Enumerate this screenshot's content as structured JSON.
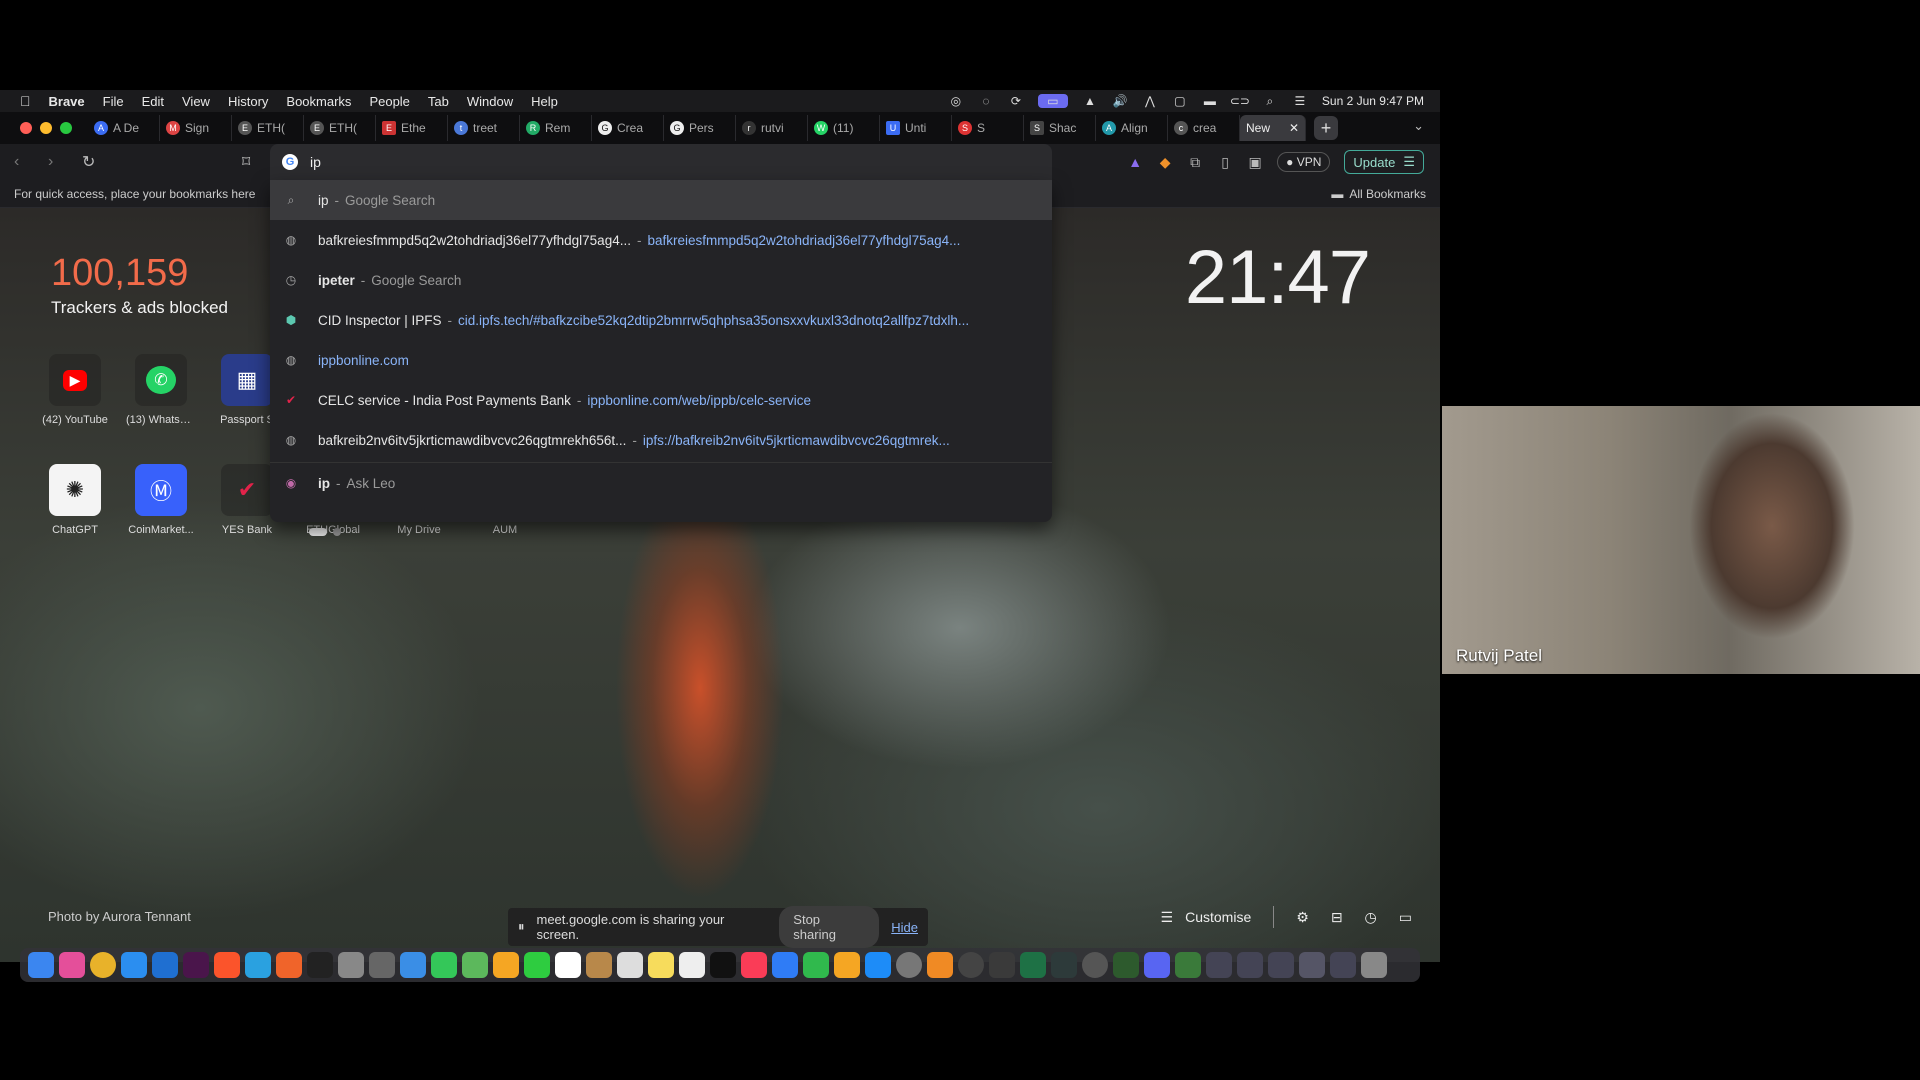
{
  "menubar": {
    "app": "Brave",
    "items": [
      "File",
      "Edit",
      "View",
      "History",
      "Bookmarks",
      "People",
      "Tab",
      "Window",
      "Help"
    ],
    "datetime": "Sun 2 Jun  9:47 PM"
  },
  "tabs": [
    {
      "label": "A De",
      "fav": "A"
    },
    {
      "label": "Sign",
      "fav": "M"
    },
    {
      "label": "ETH(",
      "fav": "E"
    },
    {
      "label": "ETH(",
      "fav": "E"
    },
    {
      "label": "Ethe",
      "fav": "E"
    },
    {
      "label": "treet",
      "fav": "t"
    },
    {
      "label": "Rem",
      "fav": "R"
    },
    {
      "label": "Crea",
      "fav": "G"
    },
    {
      "label": "Pers",
      "fav": "G"
    },
    {
      "label": "rutvi",
      "fav": "r"
    },
    {
      "label": "(11)",
      "fav": "W"
    },
    {
      "label": "Unti",
      "fav": "U"
    },
    {
      "label": "S",
      "fav": "S"
    },
    {
      "label": "Shac",
      "fav": "S"
    },
    {
      "label": "Align",
      "fav": "A"
    },
    {
      "label": "crea",
      "fav": "c"
    }
  ],
  "active_tab": {
    "label": "New",
    "close": "✕"
  },
  "toolbar": {
    "vpn": "VPN",
    "update": "Update"
  },
  "omnibox": {
    "value": "ip"
  },
  "suggestions": [
    {
      "main": "ip",
      "sep": "-",
      "sub": "Google Search",
      "url": ""
    },
    {
      "main": "bafkreiesfmmpd5q2w2tohdriadj36el77yfhdgl75ag4...",
      "sep": "-",
      "sub": "",
      "url": "bafkreiesfmmpd5q2w2tohdriadj36el77yfhdgl75ag4..."
    },
    {
      "main": "ipeter",
      "sep": "-",
      "sub": "Google Search",
      "url": ""
    },
    {
      "main": "CID Inspector | IPFS",
      "sep": "-",
      "sub": "",
      "url": "cid.ipfs.tech/#bafkzcibe52kq2dtip2bmrrw5qhphsa35onsxxvkuxl33dnotq2allfpz7tdxlh..."
    },
    {
      "main": "",
      "sep": "",
      "sub": "",
      "url": "ippbonline.com"
    },
    {
      "main": "CELC service - India Post Payments Bank",
      "sep": "-",
      "sub": "",
      "url": "ippbonline.com/web/ippb/celc-service"
    },
    {
      "main": "bafkreib2nv6itv5jkrticmawdibvcvc26qgtmrekh656t...",
      "sep": "-",
      "sub": "",
      "url": "ipfs://bafkreib2nv6itv5jkrticmawdibvcvc26qgtmrek..."
    },
    {
      "main": "ip",
      "sep": "-",
      "sub": "Ask Leo",
      "url": ""
    }
  ],
  "bookmarks": {
    "hint": "For quick access, place your bookmarks here",
    "all": "All Bookmarks"
  },
  "ntp": {
    "count": "100,159",
    "count_label": "Trackers & ads blocked",
    "clock": "21:47",
    "photo_credit": "Photo by Aurora Tennant",
    "customise": "Customise",
    "tiles_row1": [
      "(42) YouTube",
      "(13) WhatsA...",
      "Passport S"
    ],
    "tiles_row2": [
      "ChatGPT",
      "CoinMarket...",
      "YES Bank",
      "ETHGlobal",
      "My Drive",
      "AUM"
    ]
  },
  "share_banner": {
    "text": "meet.google.com is sharing your screen.",
    "stop": "Stop sharing",
    "hide": "Hide"
  },
  "participant": {
    "name": "Rutvij Patel"
  }
}
